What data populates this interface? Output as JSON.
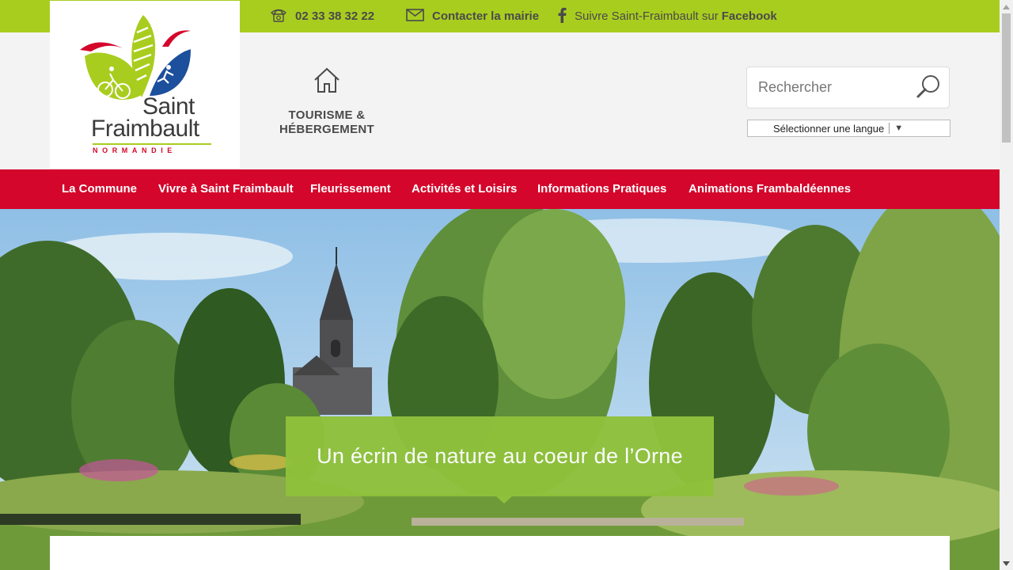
{
  "topbar": {
    "phone": "02 33 38 32 22",
    "contact": "Contacter la mairie",
    "facebook_prefix": "Suivre Saint-Fraimbault sur",
    "facebook_name": "Facebook"
  },
  "logo": {
    "line1": "Saint",
    "line2": "Fraimbault",
    "region": "NORMANDIE"
  },
  "tourism": {
    "label_line1": "TOURISME &",
    "label_line2": "HÉBERGEMENT"
  },
  "search": {
    "placeholder": "Rechercher"
  },
  "language": {
    "label": "Sélectionner une langue"
  },
  "nav": {
    "items": [
      {
        "label": "La Commune"
      },
      {
        "label": "Vivre à Saint Fraimbault"
      },
      {
        "label": "Fleurissement"
      },
      {
        "label": "Activités et Loisirs"
      },
      {
        "label": "Informations Pratiques"
      },
      {
        "label": "Animations Frambaldéennes"
      }
    ]
  },
  "hero": {
    "tagline": "Un écrin de nature au coeur de l’Orne"
  },
  "colors": {
    "topbar_green": "#a9cd1f",
    "nav_red": "#d4062b",
    "tagline_green": "#8fc13c"
  },
  "icons": [
    "phone-icon",
    "mail-icon",
    "facebook-icon",
    "home-icon",
    "search-icon",
    "dropdown-arrow-icon"
  ]
}
